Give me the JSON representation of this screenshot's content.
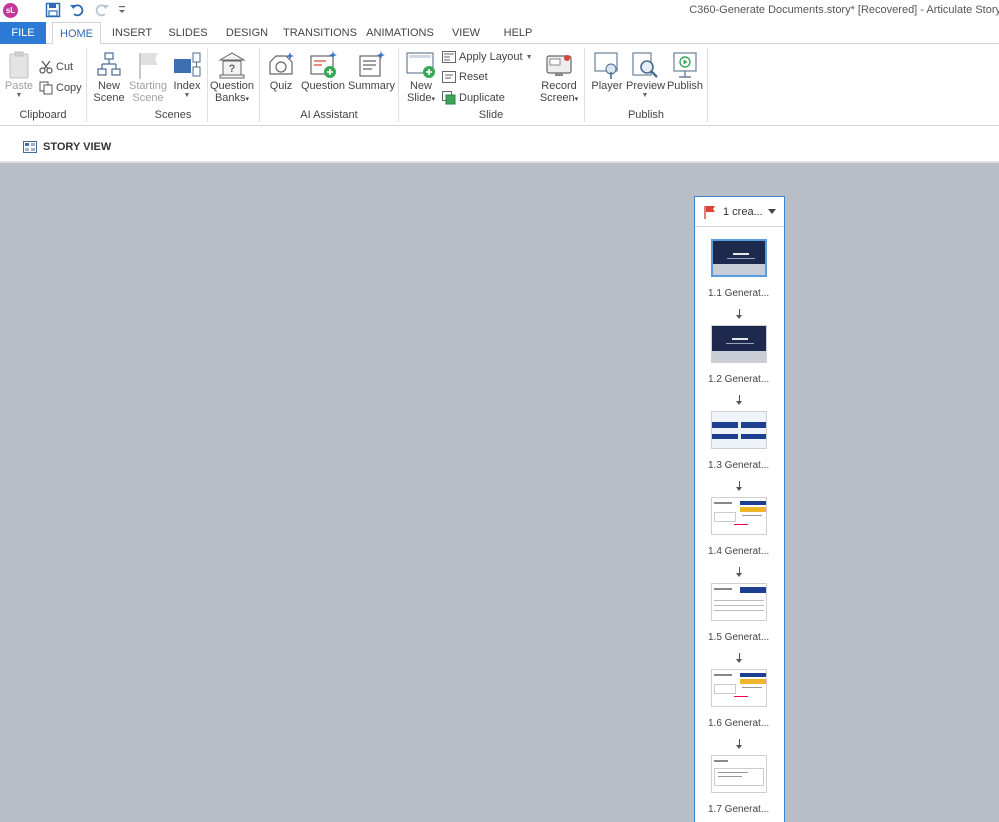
{
  "window": {
    "app_logo": "sL",
    "title": "C360-Generate Documents.story* [Recovered] - Articulate Story"
  },
  "quick_access": {
    "save_icon": "save-icon",
    "undo_icon": "undo-icon",
    "redo_icon": "redo-icon",
    "customize_icon": "dropdown-icon"
  },
  "tabs": [
    "FILE",
    "HOME",
    "INSERT",
    "SLIDES",
    "DESIGN",
    "TRANSITIONS",
    "ANIMATIONS",
    "VIEW",
    "HELP"
  ],
  "active_tab": "HOME",
  "ribbon": {
    "clipboard": {
      "label": "Clipboard",
      "paste": "Paste",
      "cut": "Cut",
      "copy": "Copy"
    },
    "scenes": {
      "label": "Scenes",
      "new_scene": [
        "New",
        "Scene"
      ],
      "starting_scene": [
        "Starting",
        "Scene"
      ],
      "index": "Index",
      "question_banks": [
        "Question",
        "Banks"
      ]
    },
    "ai_assistant": {
      "label": "AI Assistant",
      "quiz": "Quiz",
      "question": "Question",
      "summary": "Summary"
    },
    "slide": {
      "label": "Slide",
      "new_slide": [
        "New",
        "Slide"
      ],
      "apply_layout": "Apply Layout",
      "reset": "Reset",
      "duplicate": "Duplicate",
      "record_screen": [
        "Record",
        "Screen"
      ]
    },
    "publish": {
      "label": "Publish",
      "player": "Player",
      "preview": "Preview",
      "publish": "Publish"
    }
  },
  "story_view": {
    "label": "STORY VIEW"
  },
  "scene": {
    "title": "1 crea...",
    "slides": [
      {
        "label": "1.1 Generat...",
        "selected": true,
        "style": "dark"
      },
      {
        "label": "1.2 Generat...",
        "selected": false,
        "style": "dark"
      },
      {
        "label": "1.3 Generat...",
        "selected": false,
        "style": "blue-bars"
      },
      {
        "label": "1.4 Generat...",
        "selected": false,
        "style": "screenshot-orange"
      },
      {
        "label": "1.5 Generat...",
        "selected": false,
        "style": "screenshot-table"
      },
      {
        "label": "1.6 Generat...",
        "selected": false,
        "style": "screenshot-orange"
      },
      {
        "label": "1.7 Generat...",
        "selected": false,
        "style": "screenshot-plain"
      }
    ]
  },
  "colors": {
    "accent": "#2d7ad6",
    "canvas": "#b8bec7",
    "scene_border": "#3a83d1",
    "flag": "#d9433a"
  }
}
